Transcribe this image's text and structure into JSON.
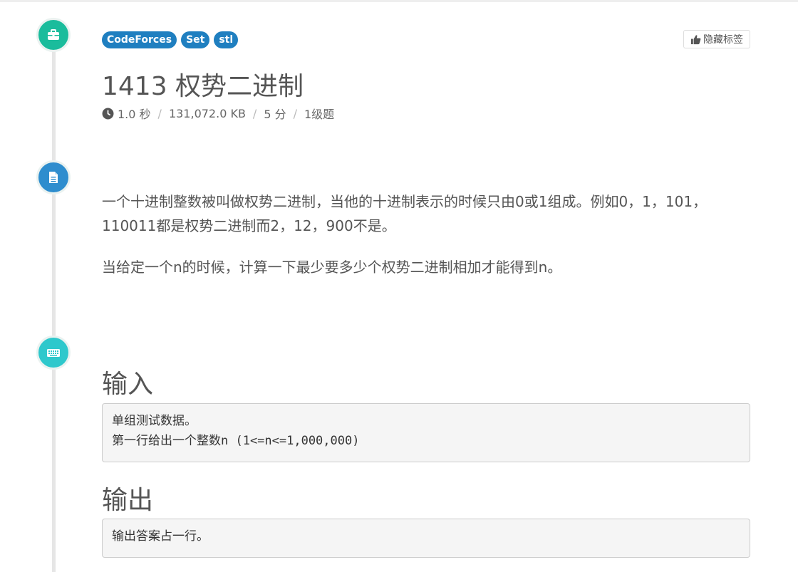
{
  "tags": [
    "CodeForces",
    "Set",
    "stl"
  ],
  "hide_tags_label": "隐藏标签",
  "problem": {
    "title": "1413 权势二进制",
    "time_limit": "1.0 秒",
    "memory_limit": "131,072.0 KB",
    "score": "5 分",
    "level": "1级题"
  },
  "description": {
    "paragraphs": [
      "一个十进制整数被叫做权势二进制，当他的十进制表示的时候只由0或1组成。例如0，1，101，110011都是权势二进制而2，12，900不是。",
      "当给定一个n的时候，计算一下最少要多少个权势二进制相加才能得到n。"
    ]
  },
  "input_section": {
    "heading": "输入",
    "lines": [
      "单组测试数据。",
      "第一行给出一个整数n (1<=n<=1,000,000)"
    ]
  },
  "output_section": {
    "heading": "输出",
    "lines": [
      "输出答案占一行。"
    ]
  },
  "colors": {
    "tag_blue": "#1f7fc0",
    "node_green": "#1abc9c",
    "node_blue": "#2e8dce",
    "node_cyan": "#2ec8cc"
  },
  "icons": {
    "node1": "briefcase-icon",
    "node2": "document-icon",
    "node3": "keyboard-icon",
    "hide_tags": "thumbs-up-icon",
    "time": "clock-icon"
  }
}
